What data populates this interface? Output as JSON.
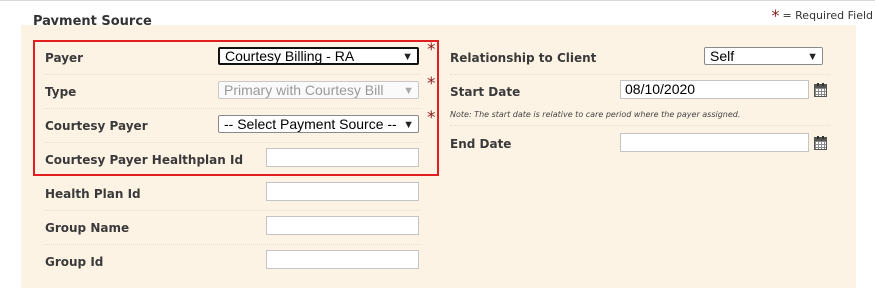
{
  "form": {
    "section_title": "Payment Source",
    "required_note": "= Required Field",
    "required_star": "*",
    "left": {
      "payer": {
        "label": "Payer",
        "value": "Courtesy Billing - RA"
      },
      "type": {
        "label": "Type",
        "value": "Primary with Courtesy Bill"
      },
      "courtesy_payer": {
        "label": "Courtesy Payer",
        "value": "-- Select Payment Source --"
      },
      "courtesy_healthplan": {
        "label": "Courtesy Payer Healthplan Id",
        "value": ""
      },
      "health_plan": {
        "label": "Health Plan Id",
        "value": ""
      },
      "group_name": {
        "label": "Group Name",
        "value": ""
      },
      "group_id": {
        "label": "Group Id",
        "value": ""
      }
    },
    "right": {
      "relationship": {
        "label": "Relationship to Client",
        "value": "Self"
      },
      "start_date": {
        "label": "Start Date",
        "value": "08/10/2020"
      },
      "start_note": "Note: The start date is relative to care period where the payer assigned.",
      "end_date": {
        "label": "End Date",
        "value": ""
      }
    }
  },
  "icons": {
    "dropdown": "chevron-down-icon",
    "calendar": "calendar-icon",
    "required": "asterisk"
  },
  "colors": {
    "panel_bg": "#fdf3e5",
    "highlight_border": "#e02020",
    "required_star": "#8b1a1a"
  }
}
